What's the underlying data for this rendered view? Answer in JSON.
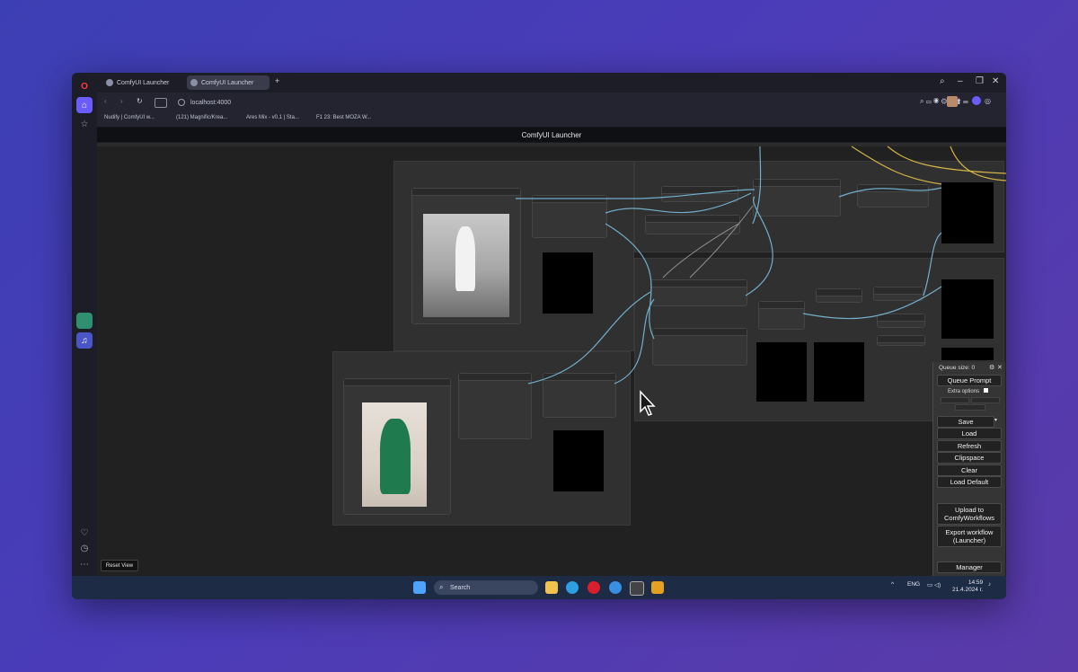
{
  "browser": {
    "tabs": [
      {
        "label": "ComfyUI Launcher",
        "active": false
      },
      {
        "label": "ComfyUI Launcher",
        "active": true
      }
    ],
    "new_tab": "+",
    "url": "localhost:4000",
    "bookmarks": [
      "Nudify | ComfyUI w...",
      "(121) Magnific/Krea...",
      "Ares Mix - v0.1 | Sta...",
      "F1 23: Best MOZA W..."
    ]
  },
  "app": {
    "title": "ComfyUI Launcher",
    "reset_view": "Reset View"
  },
  "menu": {
    "queue_size_label": "Queue size: 0",
    "queue_prompt": "Queue Prompt",
    "extra_options": "Extra options",
    "save": "Save",
    "load": "Load",
    "refresh": "Refresh",
    "clipspace": "Clipspace",
    "clear": "Clear",
    "load_default": "Load Default",
    "upload": "Upload to ComfyWorkflows",
    "export": "Export workflow (Launcher)",
    "manager": "Manager"
  },
  "taskbar": {
    "search_placeholder": "Search",
    "lang": "ENG",
    "time": "14:59",
    "date": "21.4.2024 г."
  },
  "colors": {
    "canvas": "#212121",
    "node": "#353535",
    "link_blue": "#7fc4e6",
    "link_yellow": "#e6c24a",
    "accent_browser": "#6b5cff"
  },
  "icons": {
    "opera": "opera-icon",
    "home": "home-icon",
    "star": "star-icon",
    "heart": "heart-icon",
    "history": "history-icon",
    "windows": "windows-icon"
  }
}
